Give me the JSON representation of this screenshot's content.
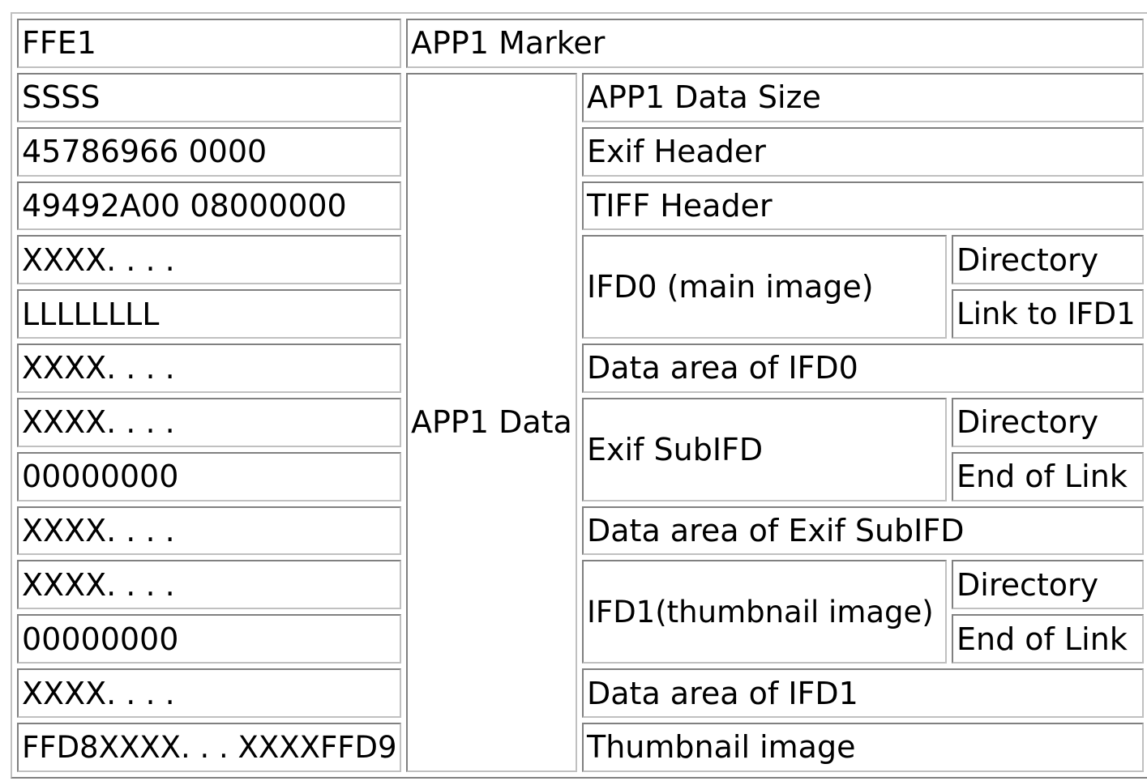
{
  "rows": [
    {
      "hex": "FFE1",
      "desc": "APP1 Marker"
    },
    {
      "hex": "SSSS",
      "group": "APP1 Data",
      "desc": "APP1 Data Size"
    },
    {
      "hex": "45786966 0000",
      "desc": "Exif Header"
    },
    {
      "hex": "49492A00 08000000",
      "desc": "TIFF Header"
    },
    {
      "hex": "XXXX. . . .",
      "section": "IFD0 (main image)",
      "part": "Directory"
    },
    {
      "hex": "LLLLLLLL",
      "part": "Link to IFD1"
    },
    {
      "hex": "XXXX. . . .",
      "desc": "Data area of IFD0"
    },
    {
      "hex": "XXXX. . . .",
      "section": "Exif SubIFD",
      "part": "Directory"
    },
    {
      "hex": "00000000",
      "part": "End of Link"
    },
    {
      "hex": "XXXX. . . .",
      "desc": "Data area of Exif SubIFD"
    },
    {
      "hex": "XXXX. . . .",
      "section": "IFD1(thumbnail image)",
      "part": "Directory"
    },
    {
      "hex": "00000000",
      "part": "End of Link"
    },
    {
      "hex": "XXXX. . . .",
      "desc": "Data area of IFD1"
    },
    {
      "hex": "FFD8XXXX. . . XXXXFFD9",
      "desc": "Thumbnail image"
    }
  ]
}
